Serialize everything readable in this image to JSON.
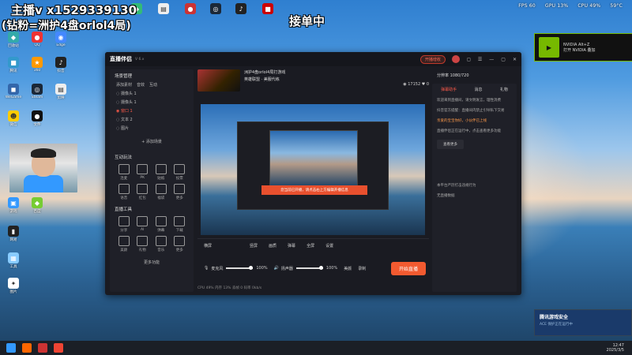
{
  "overlay": {
    "line1": "主播v x1529339130",
    "line2": "(钻粉=洲护4盘orlol4局)",
    "order": "接单中"
  },
  "stats": {
    "fps": "FPS  60",
    "gpu": "GPU 13%",
    "cpu": "CPU 49%",
    "temp": "59°C"
  },
  "app": {
    "brand": "直播伴侣",
    "version": "V 6.x",
    "pill": "开播增收",
    "winbtns": [
      "◻",
      "☰",
      "—",
      "▢",
      "✕"
    ]
  },
  "left": {
    "scene_title": "场景管理",
    "tabs": [
      "添加素材",
      "音效",
      "互动"
    ],
    "rows": [
      {
        "label": "摄像头 1",
        "active": false
      },
      {
        "label": "摄像头 1",
        "active": false
      },
      {
        "label": "窗口 1",
        "active": true
      },
      {
        "label": "文本 2",
        "active": false
      },
      {
        "label": "图片",
        "active": false
      }
    ],
    "add_scene": "+ 添加场景",
    "interact_title": "互动玩法",
    "interact": [
      "连麦",
      "PK",
      "贴纸",
      "投票",
      "语音",
      "红包",
      "福袋",
      "更多"
    ],
    "tools_title": "直播工具",
    "tools": [
      "分享",
      "AI",
      "弹幕",
      "下载",
      "美颜",
      "礼物",
      "音乐",
      "更多"
    ],
    "more": "更多功能"
  },
  "center": {
    "stream_title": "洲护4盘orlol4局打游戏",
    "category": "英雄联盟 · 美服代练",
    "viewers": "17152",
    "likes": "0",
    "banner": "您当前已开播，请点击右上方编辑开播信息",
    "toolbar": [
      "横屏",
      "竖屏",
      "画质",
      "弹幕",
      "全屏",
      "设置"
    ],
    "mic": "麦克风",
    "mic_val": "100%",
    "speaker": "扬声器",
    "speaker_val": "100%",
    "beauty": "美颜",
    "record": "录制",
    "live_btn": "开始直播",
    "status": "CPU 49%  内存 13%  丢帧 0  码率 0kb/s"
  },
  "right": {
    "top": "分辨率 1080/720",
    "tabs": [
      "弹幕助手",
      "消息",
      "礼物"
    ],
    "msgs": [
      "欢迎来到直播间，请文明发言，理性消费",
      "抖音官方提醒：直播间内禁止引导私下交易",
      "亲爱的宝宝你好，小伙伴已上线",
      "直播伴侣正在运行中，点击查看更多功能",
      "本平台严厉打击违规行为"
    ],
    "reply": "查看更多",
    "bottom": "无直播数据"
  },
  "nvidia": {
    "line1": "NVIDIA Alt+Z",
    "line2": "打开 NVIDIA 叠加"
  },
  "ace": {
    "title": "腾讯游戏安全",
    "sub": "ACE 保护正在运行中"
  },
  "clock": {
    "time": "12:47",
    "date": "2025/3/5"
  },
  "desktop_icons": [
    "回收站",
    "QQ",
    "Edge",
    "腾讯",
    "360",
    "抖音",
    "WeGame",
    "Steam",
    "剪映",
    "微信",
    "文件",
    "游戏",
    "百度",
    "网易",
    "工具",
    "图片"
  ]
}
